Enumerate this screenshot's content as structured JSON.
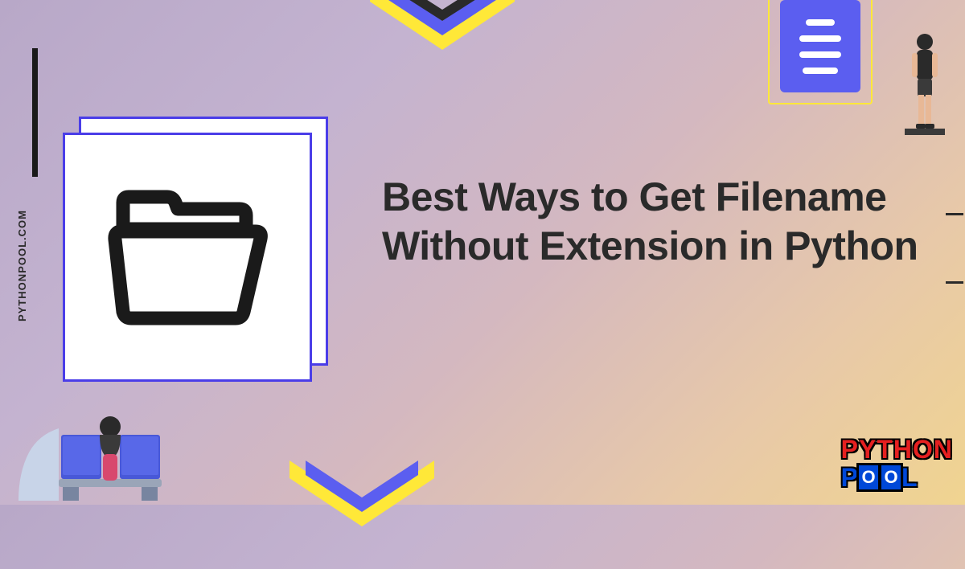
{
  "headline": "Best Ways to Get Filename Without Extension in Python",
  "sidebar_text": "PYTHONPOOL.COM",
  "logo": {
    "top": "PYTHON",
    "bottom_p": "P",
    "bottom_o1": "O",
    "bottom_o2": "O",
    "bottom_l": "L"
  },
  "colors": {
    "accent_purple": "#5b5ef0",
    "accent_yellow": "#ffe838",
    "text_dark": "#2a2a2a",
    "logo_red": "#e62020",
    "logo_blue": "#0048d8"
  }
}
